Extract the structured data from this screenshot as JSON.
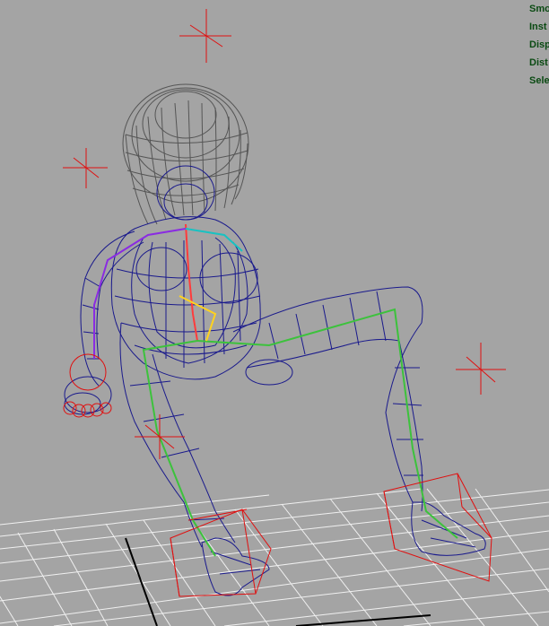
{
  "viewport": {
    "background": "#a4a4a4",
    "wireframe_color": "#1a1a8c",
    "hair_color": "#555555",
    "locator_color": "#e01010",
    "bone_colors": [
      "#3cc23c",
      "#ffd21e",
      "#ff3b3b",
      "#8a2be2",
      "#19c2c2"
    ],
    "grid_color": "#f0f0f0",
    "axis_color": "#000000"
  },
  "hud": {
    "lines": [
      "Smo",
      "Inst",
      "Disp",
      "Dist",
      "Sele"
    ]
  },
  "icons": {
    "locator": "locator-cross-icon",
    "ik_handle": "ik-handle-box-icon",
    "wrist_control": "wrist-circle-control-icon"
  }
}
